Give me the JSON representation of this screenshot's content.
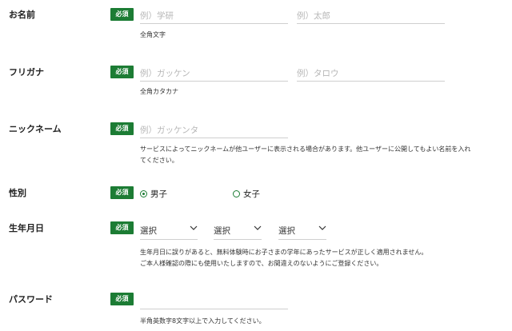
{
  "required_badge": "必須",
  "fields": {
    "name": {
      "label": "お名前",
      "last_placeholder": "例）学研",
      "first_placeholder": "例）太郎",
      "hint": "全角文字"
    },
    "kana": {
      "label": "フリガナ",
      "last_placeholder": "例）ガッケン",
      "first_placeholder": "例）タロウ",
      "hint": "全角カタカナ"
    },
    "nickname": {
      "label": "ニックネーム",
      "placeholder": "例）ガッケンタ",
      "hint_line1": "サービスによってニックネームが他ユーザーに表示される場合があります。他ユーザーに公開してもよい名前を入れ",
      "hint_line2": "てください。"
    },
    "gender": {
      "label": "性別",
      "male": "男子",
      "female": "女子",
      "selected": "男子"
    },
    "birthday": {
      "label": "生年月日",
      "year": "選択",
      "month": "選択",
      "day": "選択",
      "hint_line1": "生年月日に誤りがあると、無料体験時にお子さまの学年にあったサービスが正しく適用されません。",
      "hint_line2": "ご本人様確認の際にも使用いたしますので、お間違えのないようにご登録ください。"
    },
    "password": {
      "label": "パスワード",
      "hint": "半角英数字8文字以上で入力してください。"
    }
  },
  "colors": {
    "accent": "#1c7c34",
    "border": "#cfcfcf",
    "placeholder": "#b6b6b6"
  },
  "icons": {
    "select_chevron": "chevron-down-icon"
  }
}
